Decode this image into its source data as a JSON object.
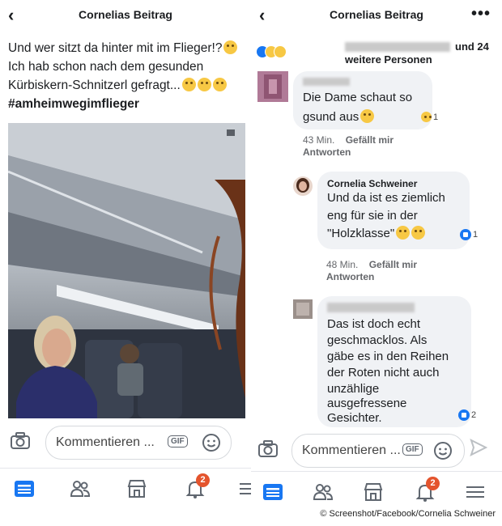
{
  "left": {
    "header_title": "Cornelias Beitrag",
    "post_line1": "Und wer sitzt da hinter mit im Flieger!?",
    "post_line2": "Ich hab schon nach dem gesunden",
    "post_line3": "Kürbiskern-Schnitzerl gefragt...",
    "hashtag": "#amheimwegimflieger",
    "composer_placeholder": "Kommentieren ...",
    "gif_label": "GIF",
    "notification_count": "2"
  },
  "right": {
    "header_title": "Cornelias Beitrag",
    "more_label": "•••",
    "reactions_text": "und 24",
    "reactions_text2": "weitere Personen",
    "comments": [
      {
        "text_line1": "Die Dame schaut so",
        "text_line2": "gsund aus",
        "reaction_count": "1",
        "time": "43 Min.",
        "like_label": "Gefällt mir",
        "reply_label": "Antworten"
      },
      {
        "name": "Cornelia Schweiner",
        "text_line1": "Und da ist es ziemlich",
        "text_line2": "eng für sie in der",
        "text_line3": "\"Holzklasse\"",
        "reaction_count": "1",
        "time": "48 Min.",
        "like_label": "Gefällt mir",
        "reply_label": "Antworten"
      },
      {
        "text_line1": "Das ist doch echt",
        "text_line2": "geschmacklos. Als",
        "text_line3": "gäbe es in den Reihen",
        "text_line4": "der Roten nicht auch",
        "text_line5": "unzählige",
        "text_line6": "ausgefressene",
        "text_line7": "Gesichter.",
        "reaction_count": "2"
      }
    ],
    "composer_placeholder": "Kommentieren ...",
    "gif_label": "GIF",
    "notification_count": "2"
  },
  "credit": "© Screenshot/Facebook/Cornelia Schweiner",
  "colors": {
    "facebook_blue": "#1877f2",
    "badge_red": "#e4542d",
    "bubble_gray": "#f0f2f5"
  }
}
